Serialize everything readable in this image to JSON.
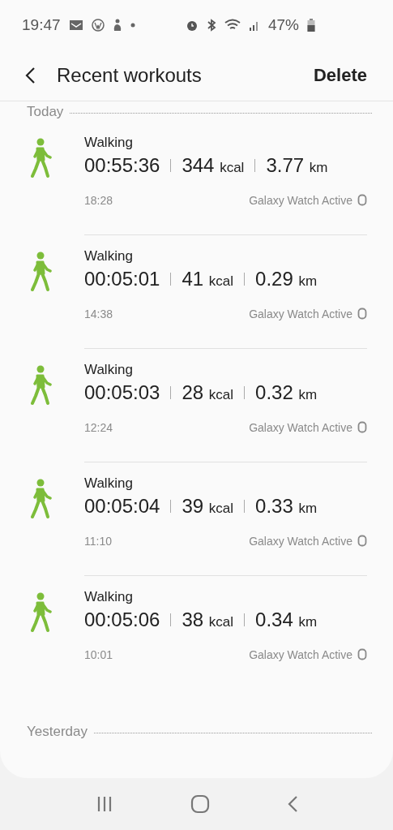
{
  "status_bar": {
    "time": "19:47",
    "battery": "47%"
  },
  "header": {
    "title": "Recent workouts",
    "action": "Delete"
  },
  "sections": [
    {
      "label": "Today",
      "workouts": [
        {
          "activity": "Walking",
          "duration": "00:55:36",
          "calories": "344",
          "calories_unit": "kcal",
          "distance": "3.77",
          "distance_unit": "km",
          "time": "18:28",
          "device": "Galaxy Watch Active"
        },
        {
          "activity": "Walking",
          "duration": "00:05:01",
          "calories": "41",
          "calories_unit": "kcal",
          "distance": "0.29",
          "distance_unit": "km",
          "time": "14:38",
          "device": "Galaxy Watch Active"
        },
        {
          "activity": "Walking",
          "duration": "00:05:03",
          "calories": "28",
          "calories_unit": "kcal",
          "distance": "0.32",
          "distance_unit": "km",
          "time": "12:24",
          "device": "Galaxy Watch Active"
        },
        {
          "activity": "Walking",
          "duration": "00:05:04",
          "calories": "39",
          "calories_unit": "kcal",
          "distance": "0.33",
          "distance_unit": "km",
          "time": "11:10",
          "device": "Galaxy Watch Active"
        },
        {
          "activity": "Walking",
          "duration": "00:05:06",
          "calories": "38",
          "calories_unit": "kcal",
          "distance": "0.34",
          "distance_unit": "km",
          "time": "10:01",
          "device": "Galaxy Watch Active"
        }
      ]
    },
    {
      "label": "Yesterday"
    }
  ]
}
